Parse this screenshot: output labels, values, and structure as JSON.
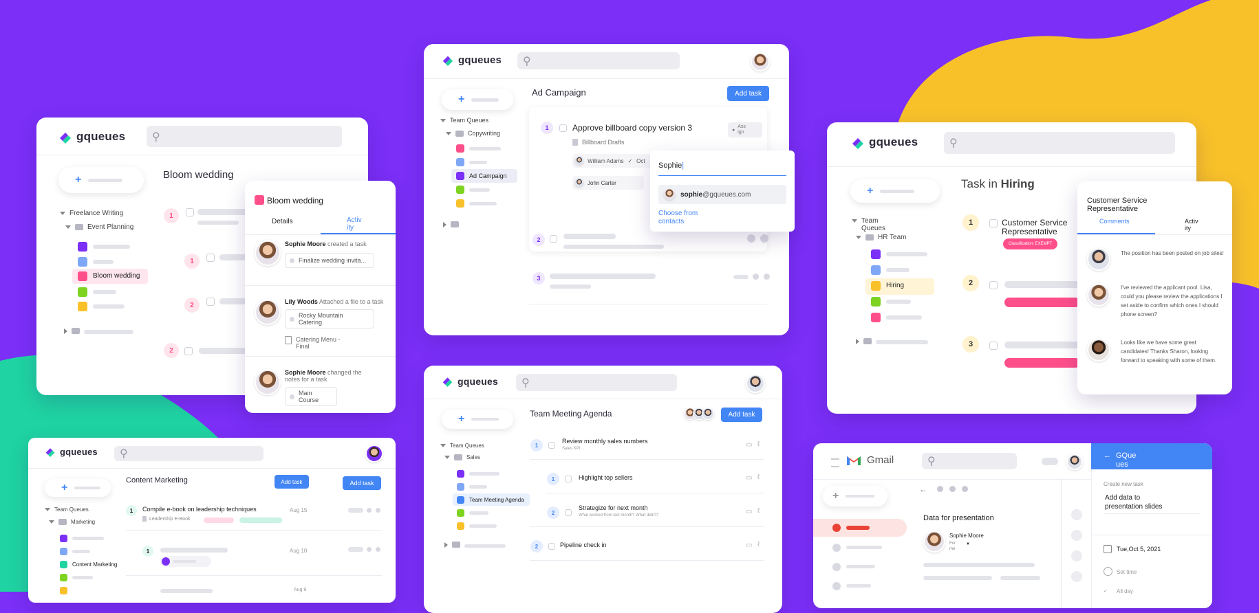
{
  "colors": {
    "bg_purple": "#7b2ff7",
    "bg_green": "#1fd3a2",
    "bg_yellow": "#f8c12a",
    "blue": "#4285f4",
    "pink": "#ff4f8b"
  },
  "logo_text": "gqueues",
  "card_bloom": {
    "tree": {
      "root": "Freelance Writing",
      "folder": "Event Planning",
      "selected": "Bloom wedding"
    },
    "title": "Bloom wedding",
    "nums": [
      "1",
      "1",
      "2",
      "2"
    ]
  },
  "panel_bloom": {
    "title": "Bloom wedding",
    "tab_details": "Details",
    "tab_activity": "Activ\nity",
    "items": [
      {
        "user": "Sophie Moore",
        "action": "created a task",
        "chip": "Finalize wedding invita..."
      },
      {
        "user": "Lily Woods",
        "action": "Attached a file to a task",
        "chip": "Rocky Mountain Catering",
        "file": "Catering Menu - Final"
      },
      {
        "user": "Sophie Moore",
        "action": "changed the notes for a task",
        "chip": "Main Course"
      }
    ]
  },
  "card_ad": {
    "tree": {
      "root": "Team Queues",
      "folder": "Copywriting",
      "selected": "Ad Campaign"
    },
    "title": "Ad Campaign",
    "add_task": "Add task",
    "task1": {
      "num": "1",
      "title": "Approve billboard copy version 3",
      "sub": "Billboard Drafts",
      "assign": "Ass\nign",
      "person1": "William Adams",
      "person1_suffix": "Oct",
      "person2": "John Carter"
    },
    "nums": [
      "2",
      "3"
    ],
    "popup": {
      "input": "Sophie",
      "caret": "|",
      "email_bold": "sophie",
      "email_rest": "@gqueues.com",
      "choose": "Choose from\ncontacts"
    }
  },
  "card_hiring": {
    "tree": {
      "root": "Team\nQueues",
      "folder": "HR Team",
      "selected": "Hiring"
    },
    "title_prefix": "Task in ",
    "title_bold": "Hiring",
    "task1": "Customer Service\nRepresentative",
    "badge": "Classification: EXEMPT",
    "nums": [
      "1",
      "2",
      "3"
    ]
  },
  "panel_comments": {
    "title": "Customer Service\nRepresentative",
    "tab_comments": "Comments",
    "tab_activity": "Activ\nity",
    "comments": [
      "The position has been posted on job sites!",
      "I've reviewed the applicant pool. Lisa, could you please review the applications I set aside to confirm which ones I should phone screen?",
      "Looks like we have some great candidates! Thanks Sharon, looking forward to speaking with some of them."
    ]
  },
  "card_content": {
    "tree": {
      "root": "Team Queues",
      "folder": "Marketing",
      "selected": "Content Marketing"
    },
    "title": "Content Marketing",
    "add_task_1": "Add task",
    "add_task_2": "Add task",
    "task1": {
      "num": "1",
      "title": "Compile e-book on leadership techniques",
      "sub": "Leadership E-Book",
      "date": "Aug 15"
    },
    "task2": {
      "num": "1",
      "date": "Aug 10"
    },
    "task3": {
      "date": "Aug 8"
    }
  },
  "card_meeting": {
    "tree": {
      "root": "Team Queues",
      "folder": "Sales",
      "selected": "Team Meeting Agenda"
    },
    "title": "Team Meeting Agenda",
    "add_task": "Add task",
    "tasks": [
      {
        "num": "1",
        "title": "Review monthly sales numbers",
        "sub": "Sales KPI"
      },
      {
        "num": "1",
        "title": "Highlight top sellers",
        "sub": ""
      },
      {
        "num": "2",
        "title": "Strategize for next month",
        "sub": "What worked from last month? What didn't?"
      },
      {
        "num": "2",
        "title": "Pipeline check in",
        "sub": ""
      }
    ]
  },
  "card_gmail": {
    "brand": "Gmail",
    "email_title": "Data for presentation",
    "sender": "Sophie Moore",
    "sender_sub": "For\nme",
    "side": {
      "header": "GQue\nues",
      "create_label": "Create new task",
      "task_title": "Add data to\npresentation slides",
      "date": "Tue,Oct 5, 2021",
      "set_time": "Set time",
      "all_day": "All day"
    }
  }
}
